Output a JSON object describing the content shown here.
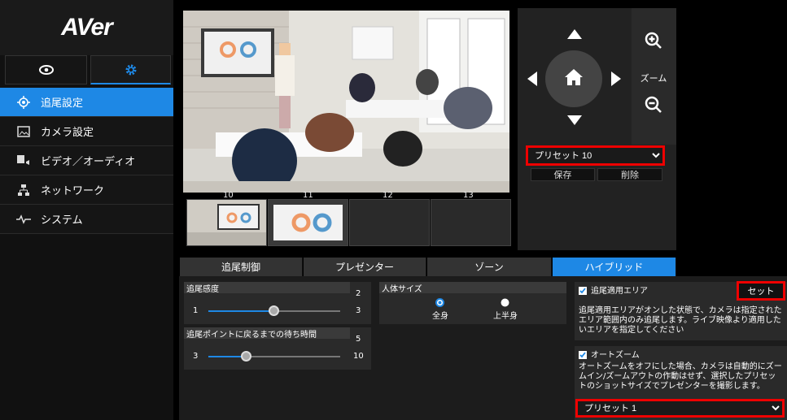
{
  "brand": {
    "logo": "AVer"
  },
  "mode_tabs": {
    "view_icon": "eye-icon",
    "settings_icon": "gear-icon"
  },
  "sidebar": {
    "items": [
      {
        "label": "追尾設定",
        "icon": "tracking-icon",
        "active": true
      },
      {
        "label": "カメラ設定",
        "icon": "image-icon",
        "active": false
      },
      {
        "label": "ビデオ／オーディオ",
        "icon": "video-audio-icon",
        "active": false
      },
      {
        "label": "ネットワーク",
        "icon": "network-icon",
        "active": false
      },
      {
        "label": "システム",
        "icon": "pulse-icon",
        "active": false
      }
    ]
  },
  "preview": {
    "zone_labels": [
      "10",
      "11",
      "12",
      "13"
    ]
  },
  "ptz": {
    "zoom_label": "ズーム",
    "preset_selected": "プリセット 10",
    "save_label": "保存",
    "delete_label": "削除"
  },
  "tabs": [
    "追尾制御",
    "プレゼンター",
    "ゾーン",
    "ハイブリッド"
  ],
  "active_tab": "ハイブリッド",
  "sensitivity": {
    "title": "追尾感度",
    "value": "2",
    "min": "1",
    "max": "3",
    "level": 0.5
  },
  "wait": {
    "title": "追尾ポイントに戻るまでの待ち時間",
    "value": "5",
    "min": "3",
    "max": "10",
    "level": 0.29
  },
  "body": {
    "title": "人体サイズ",
    "opt_full": "全身",
    "opt_upper": "上半身",
    "selected": "全身"
  },
  "area": {
    "checkbox_label": "追尾適用エリア",
    "set_label": "セット",
    "desc": "追尾適用エリアがオンした状態で、カメラは指定されたエリア範囲内のみ追尾します。ライブ映像より適用したいエリアを指定してください"
  },
  "autozoom": {
    "checkbox_label": "オートズーム",
    "desc": "オートズームをオフにした場合、カメラは自動的にズームイン/ズームアウトの作動はせず、選択したプリセットのショットサイズでプレゼンターを撮影します。",
    "preset_selected": "プリセット 1"
  },
  "colors": {
    "accent": "#1e88e5",
    "highlight": "#e00000"
  }
}
